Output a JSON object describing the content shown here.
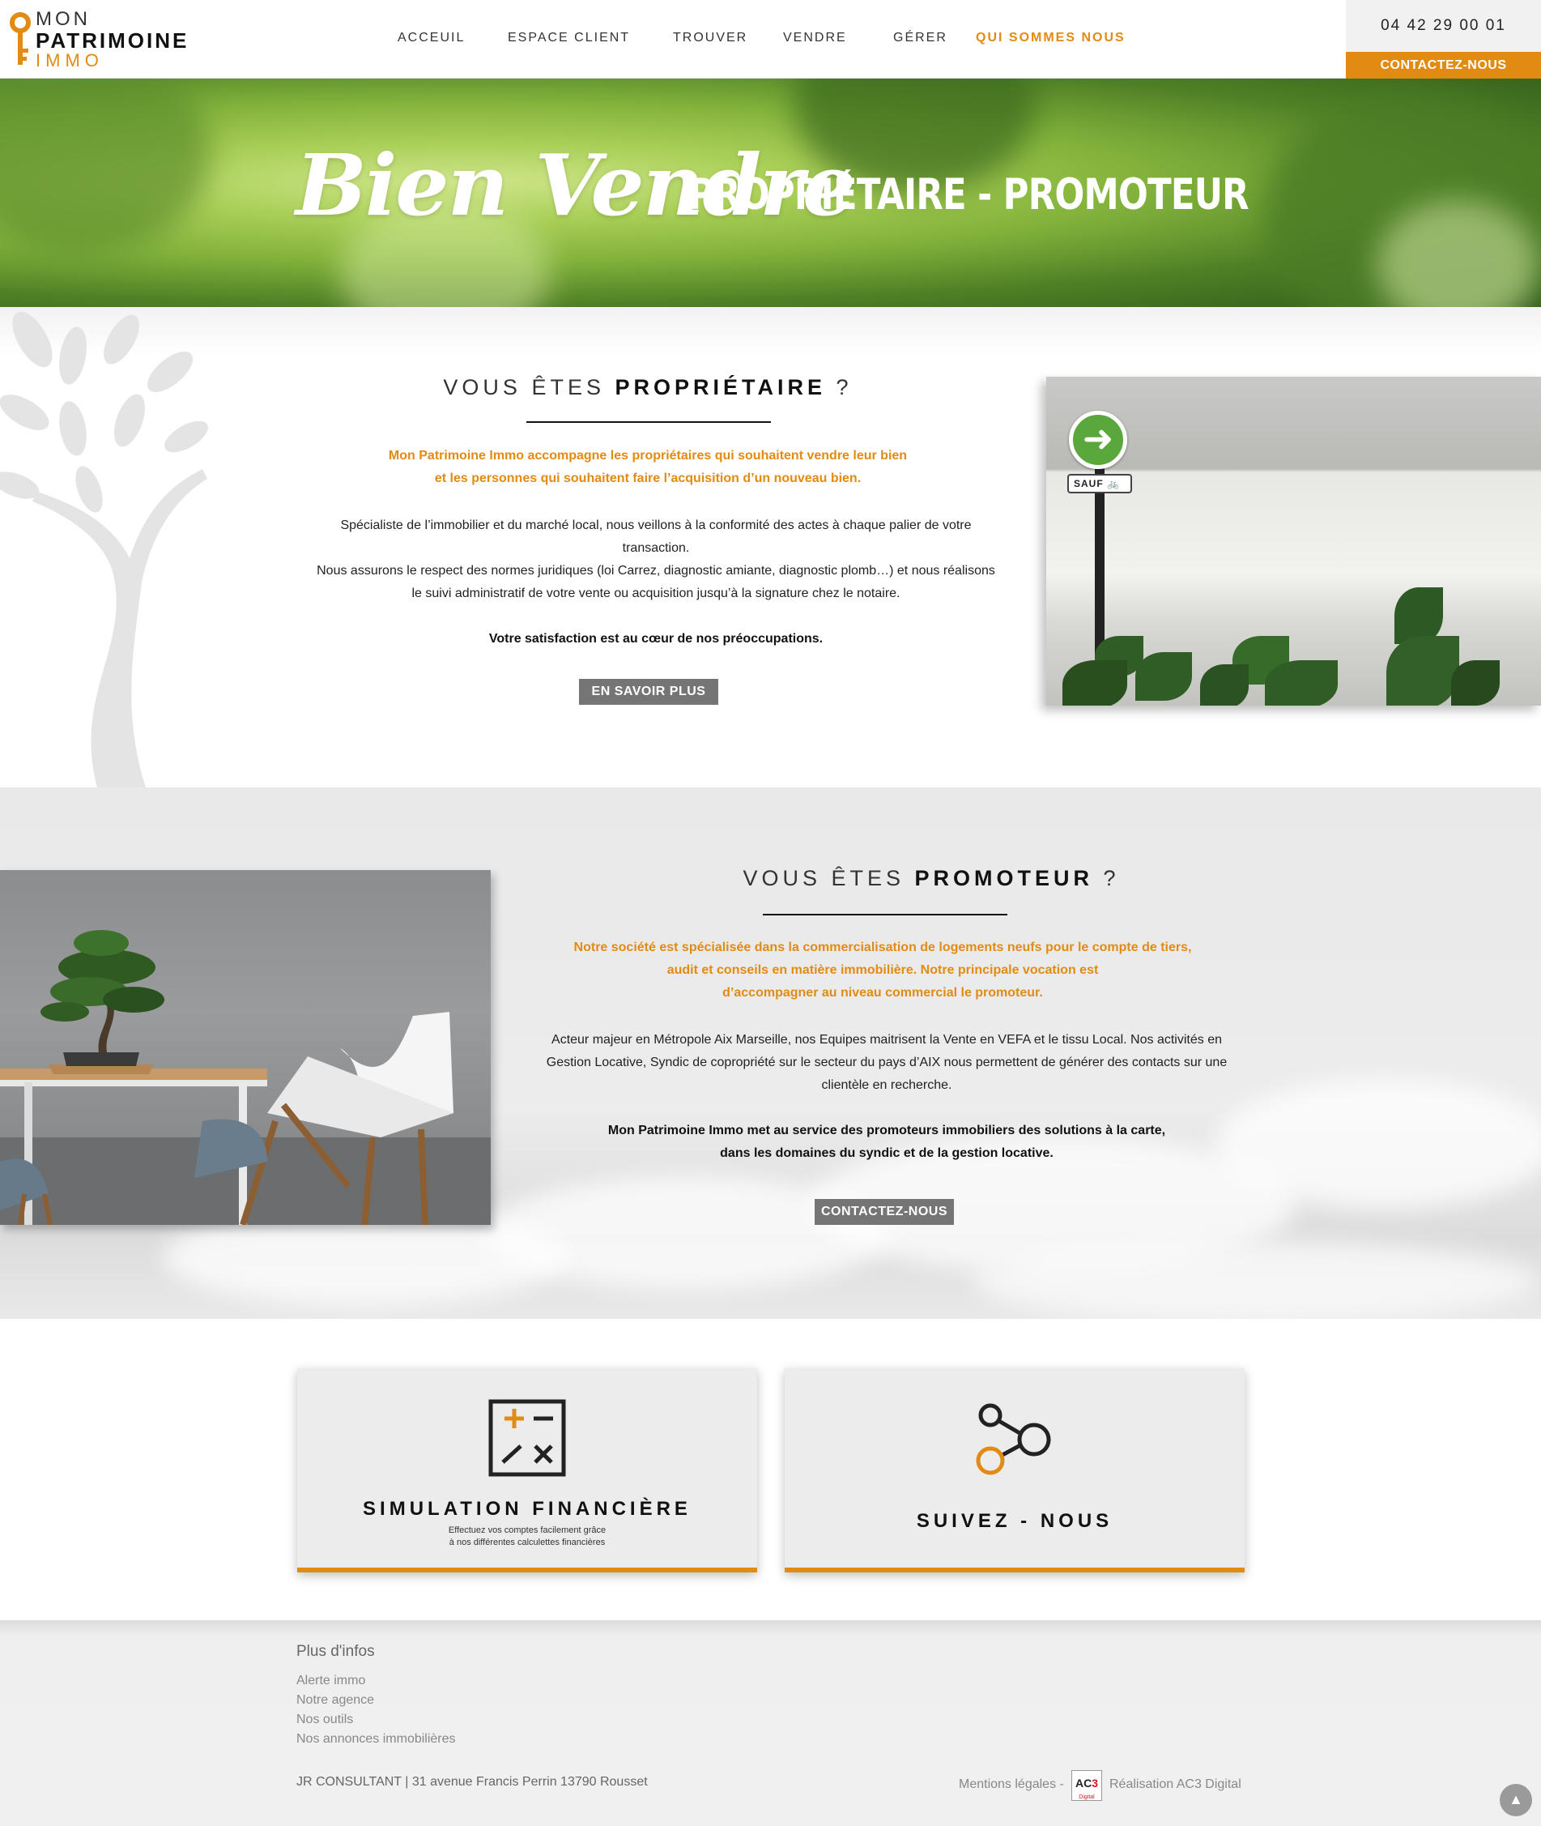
{
  "header": {
    "logo": {
      "line1": "MON",
      "line2": "PATRIMOINE",
      "line3": "IMMO"
    },
    "nav": [
      "ACCEUIL",
      "ESPACE CLIENT",
      "TROUVER",
      "VENDRE",
      "GÉRER",
      "QUI SOMMES NOUS"
    ],
    "active_nav": "QUI SOMMES NOUS",
    "phone": "04 42 29 00 01",
    "contact_label": "CONTACTEZ-NOUS"
  },
  "hero": {
    "script_title": "Bien Vendre",
    "caps_title": "PROPRIÉTAIRE - PROMOTEUR"
  },
  "proprietaire": {
    "title_prefix": "VOUS ÊTES",
    "title_bold": "PROPRIÉTAIRE",
    "title_suffix": "?",
    "intro_line1": "Mon Patrimoine Immo accompagne les propriétaires qui souhaitent vendre leur bien",
    "intro_line2": "et les personnes qui souhaitent faire l’acquisition d’un nouveau bien.",
    "body_line1": "Spécialiste de l’immobilier et du marché local, nous veillons à la conformité des actes à chaque palier de votre",
    "body_line2": "transaction.",
    "body_line3": "Nous assurons le respect des normes juridiques (loi Carrez, diagnostic amiante, diagnostic plomb…) et nous réalisons",
    "body_line4": "le suivi administratif de votre vente ou acquisition jusqu’à la signature chez le notaire.",
    "closing": "Votre satisfaction est au cœur de nos préoccupations.",
    "button": "EN SAVOIR PLUS",
    "sign_label": "SAUF"
  },
  "promoteur": {
    "title_prefix": "VOUS ÊTES",
    "title_bold": "PROMOTEUR",
    "title_suffix": "?",
    "intro_line1": "Notre société est spécialisée dans la commercialisation de logements neufs pour le compte de tiers,",
    "intro_line2": "audit et conseils en matière immobilière. Notre principale vocation est",
    "intro_line3": "d’accompagner au niveau commercial le promoteur.",
    "body_line1": "Acteur majeur en Métropole Aix Marseille, nos Equipes maitrisent la Vente en VEFA et le tissu Local. Nos activités en",
    "body_line2": "Gestion Locative, Syndic de copropriété sur le secteur du pays d’AIX nous permettent de générer des contacts sur une",
    "body_line3": "clientèle en recherche.",
    "closing_line1": "Mon Patrimoine Immo met au service des promoteurs immobiliers des solutions à la carte,",
    "closing_line2": "dans les domaines du syndic et de la gestion locative.",
    "button": "CONTACTEZ-NOUS"
  },
  "cards": [
    {
      "title": "SIMULATION FINANCIÈRE",
      "subtitle_line1": "Effectuez vos comptes facilement grâce",
      "subtitle_line2": "à nos différentes calculettes financières",
      "icon": "calculator-icon"
    },
    {
      "title": "SUIVEZ - NOUS",
      "icon": "share-icon"
    }
  ],
  "footer": {
    "heading": "Plus d'infos",
    "links": [
      "Alerte immo",
      "Notre agence",
      "Nos outils",
      "Nos annonces immobilières"
    ],
    "address": "JR CONSULTANT | 31 avenue Francis Perrin 13790 Rousset",
    "legal": "Mentions légales -",
    "badge_main": "AC",
    "badge_accent": "3",
    "badge_sub": "Digital",
    "realisation": "Réalisation AC3 Digital"
  },
  "colors": {
    "accent": "#e28b12",
    "button_gray": "#757575"
  }
}
